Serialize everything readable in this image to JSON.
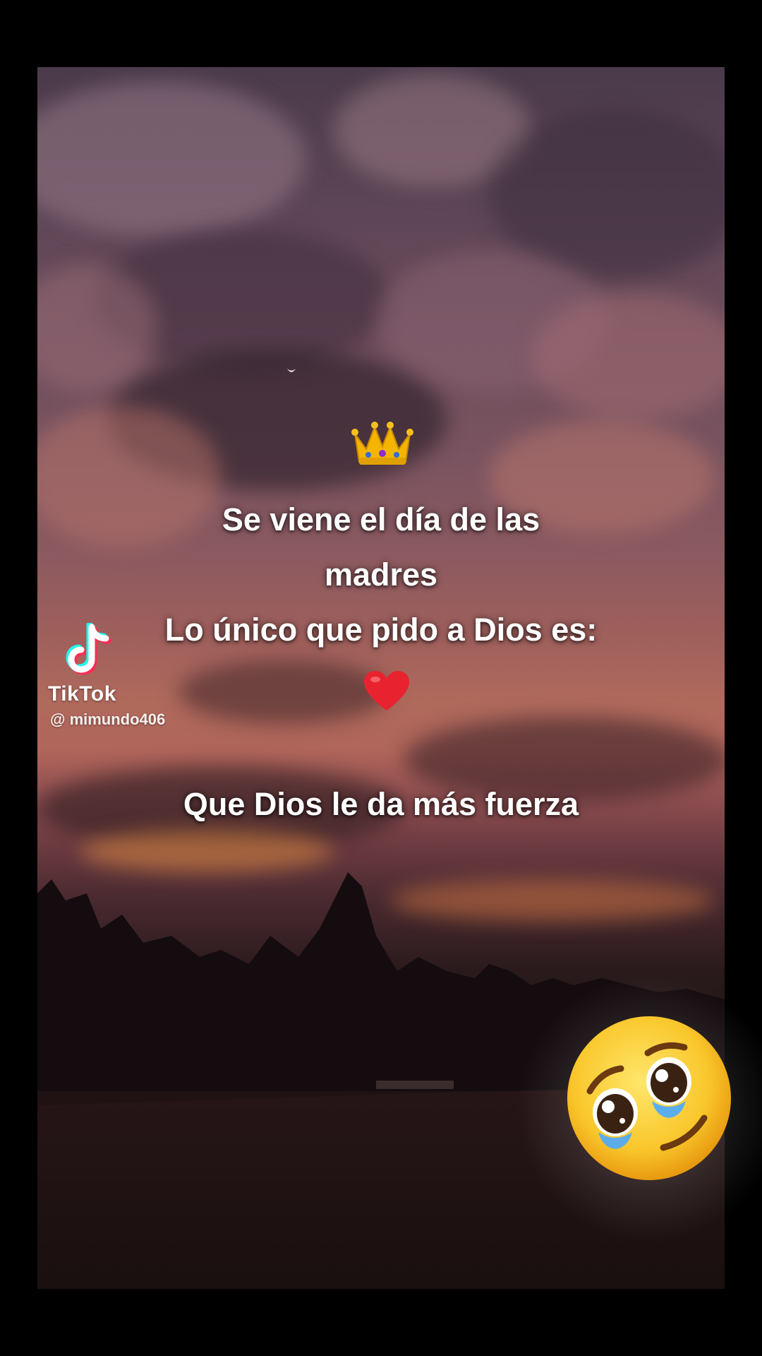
{
  "overlay": {
    "line1": "Se viene el día de las",
    "line2": "madres",
    "line3": "Lo único que pido a Dios es:",
    "line5": "Que Dios le da más fuerza"
  },
  "watermark": {
    "brand": "TikTok",
    "username": "@ mimundo406"
  },
  "icons": {
    "crown": "crown-icon",
    "heart": "red-heart-icon",
    "emoji": "pleading-face-icon",
    "tiktok": "tiktok-logo-icon"
  },
  "colors": {
    "frame": "#000000",
    "text": "#ffffff",
    "heart": "#e8232f",
    "tiktok_cyan": "#25f4ee",
    "tiktok_red": "#fe2c55"
  }
}
